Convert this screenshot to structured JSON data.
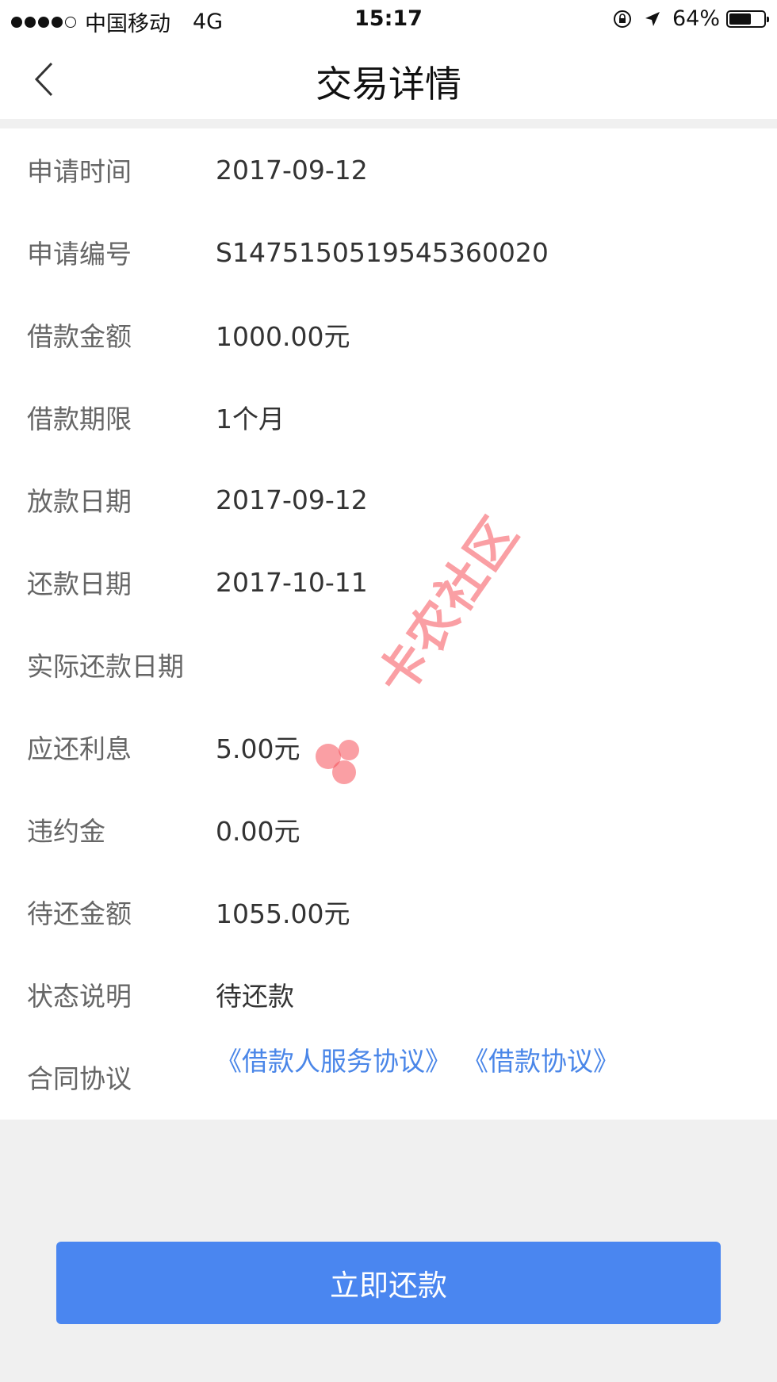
{
  "status_bar": {
    "carrier": "中国移动",
    "network": "4G",
    "time": "15:17",
    "battery": "64%",
    "battery_level": 0.64
  },
  "nav": {
    "title": "交易详情",
    "back_icon": "chevron-left-icon"
  },
  "details": [
    {
      "label": "申请时间",
      "value": "2017-09-12"
    },
    {
      "label": "申请编号",
      "value": "S1475150519545360020"
    },
    {
      "label": "借款金额",
      "value": "1000.00元"
    },
    {
      "label": "借款期限",
      "value": "1个月"
    },
    {
      "label": "放款日期",
      "value": "2017-09-12"
    },
    {
      "label": "还款日期",
      "value": "2017-10-11"
    },
    {
      "label": "实际还款日期",
      "value": ""
    },
    {
      "label": "应还利息",
      "value": "5.00元"
    },
    {
      "label": "违约金",
      "value": "0.00元"
    },
    {
      "label": "待还金额",
      "value": "1055.00元"
    },
    {
      "label": "状态说明",
      "value": "待还款"
    }
  ],
  "contract": {
    "label": "合同协议",
    "links": [
      "《借款人服务协议》",
      "《借款协议》"
    ]
  },
  "watermark": "卡农社区",
  "repay_button": "立即还款",
  "colors": {
    "accent": "#4a86f0",
    "link": "#4a86e8",
    "label": "#666666",
    "background": "#f0f0f0"
  }
}
